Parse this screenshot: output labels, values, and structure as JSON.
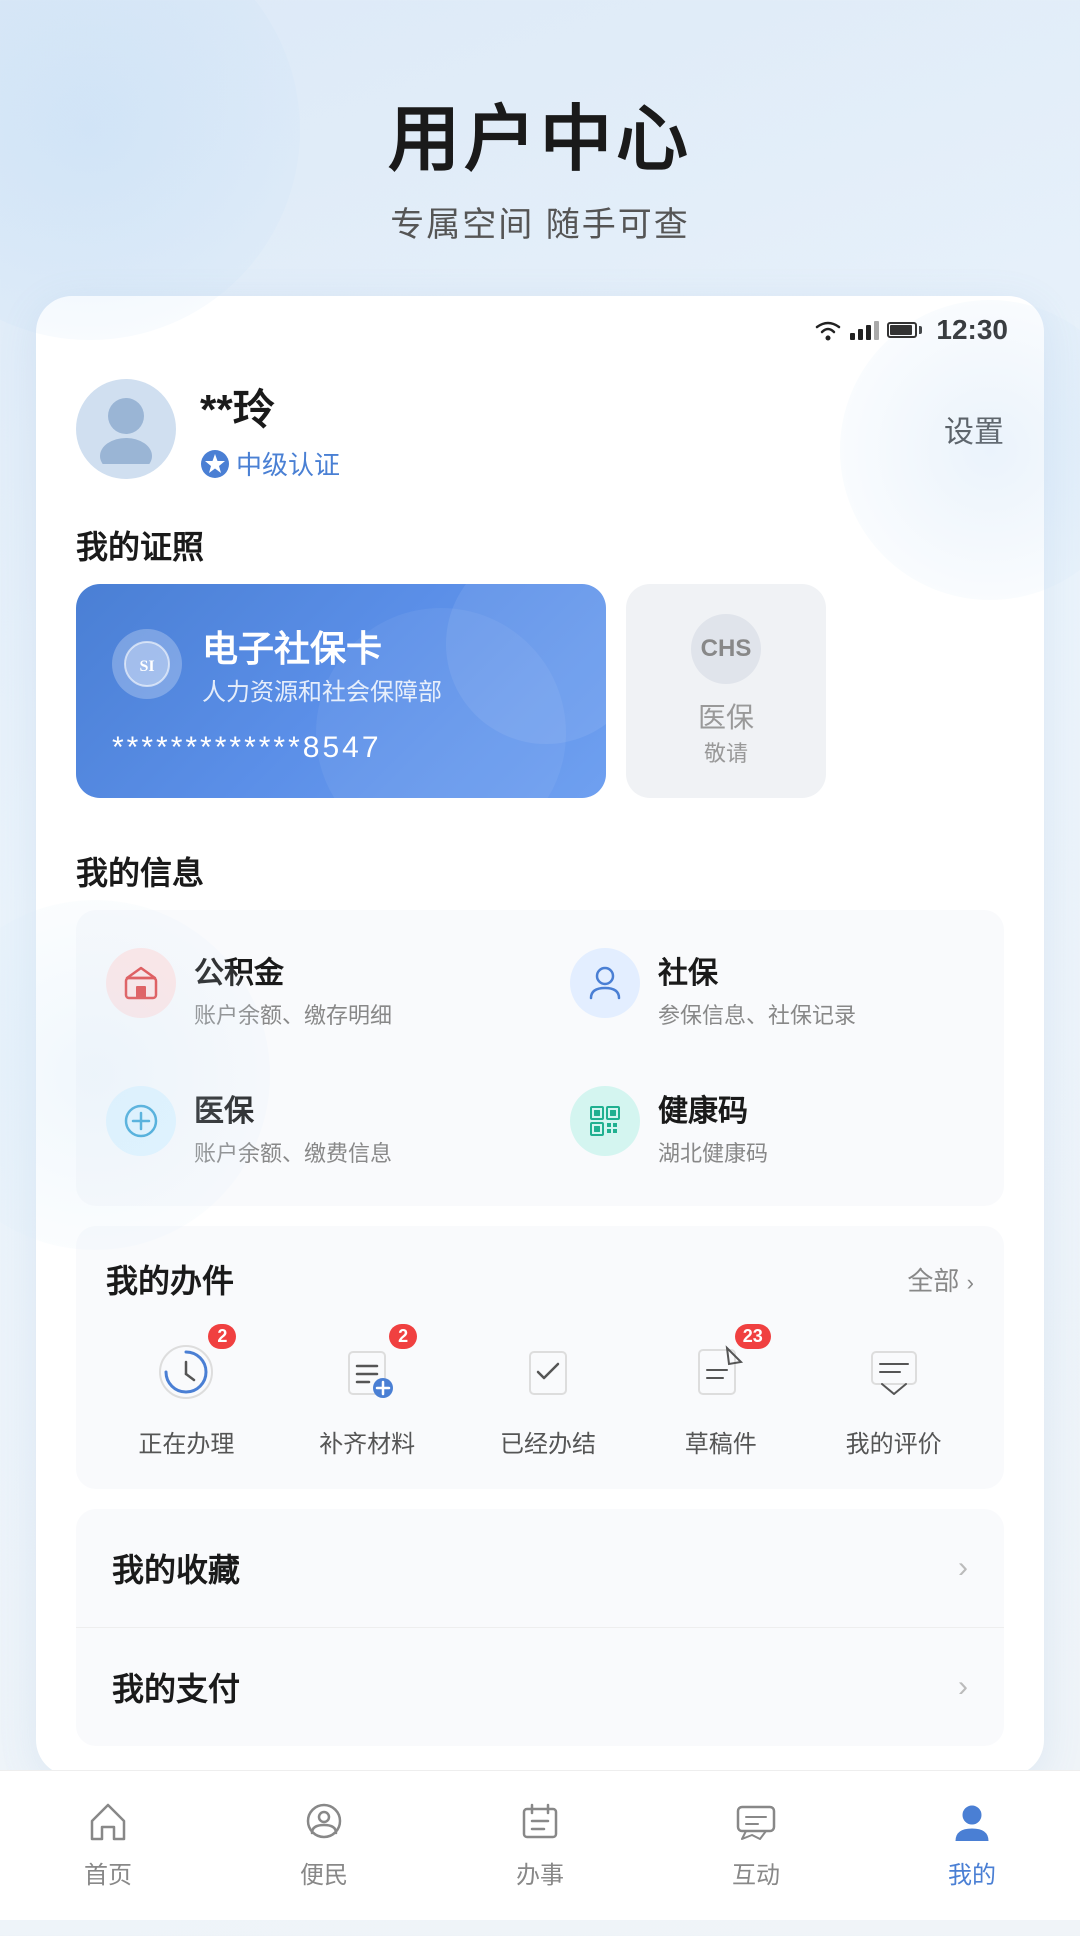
{
  "page": {
    "title": "用户中心",
    "subtitle": "专属空间 随手可查"
  },
  "statusBar": {
    "time": "12:30"
  },
  "profile": {
    "name": "**玲",
    "certLevel": "中级认证",
    "settingsLabel": "设置"
  },
  "certificates": {
    "sectionTitle": "我的证照",
    "socialCard": {
      "title": "电子社保卡",
      "org": "人力资源和社会保障部",
      "number": "*************8547"
    },
    "healthCard": {
      "logo": "CHS",
      "hint": "敬请..."
    }
  },
  "myInfo": {
    "sectionTitle": "我的信息",
    "items": [
      {
        "title": "公积金",
        "desc": "账户余额、缴存明细",
        "iconColor": "red"
      },
      {
        "title": "社保",
        "desc": "参保信息、社保记录",
        "iconColor": "blue"
      },
      {
        "title": "医保",
        "desc": "账户余额、缴费信息",
        "iconColor": "cyan"
      },
      {
        "title": "健康码",
        "desc": "湖北健康码",
        "iconColor": "teal"
      }
    ]
  },
  "myWork": {
    "sectionTitle": "我的办件",
    "allLabel": "全部",
    "chevron": ">",
    "items": [
      {
        "label": "正在办理",
        "badge": "2",
        "hasBadge": true
      },
      {
        "label": "补齐材料",
        "badge": "2",
        "hasBadge": true
      },
      {
        "label": "已经办结",
        "badge": null,
        "hasBadge": false
      },
      {
        "label": "草稿件",
        "badge": "23",
        "hasBadge": true
      },
      {
        "label": "我的评价",
        "badge": null,
        "hasBadge": false
      }
    ]
  },
  "myList": [
    {
      "label": "我的收藏"
    },
    {
      "label": "我的支付"
    }
  ],
  "bottomNav": {
    "items": [
      {
        "label": "首页",
        "active": false
      },
      {
        "label": "便民",
        "active": false
      },
      {
        "label": "办事",
        "active": false
      },
      {
        "label": "互动",
        "active": false
      },
      {
        "label": "我的",
        "active": true
      }
    ]
  }
}
